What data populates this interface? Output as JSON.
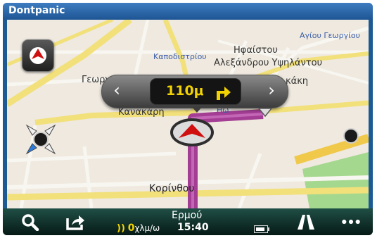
{
  "window": {
    "title": "Dontpanic"
  },
  "map": {
    "streets": {
      "agiou_georgiou": "Αγίου Γεωργίου",
      "kapodistriou": "Καποδιστρίου",
      "ifaistou": "Ηφαίστου",
      "alexandrou_ypsilantou": "Αλεξάνδρου Υψηλάντου",
      "georg_partial": "Γεωργ",
      "akaki_partial": "κάκη",
      "io_partial": "Ηω",
      "kanakari": "Κανακάρη",
      "korinthou": "Κορίνθου"
    }
  },
  "controls": {
    "compass_icon": "north-up-arrow-icon",
    "pan_icon": "pan-arrows-icon",
    "zoom_icon": "zoom-dot-icon"
  },
  "instruction": {
    "distance": "110μ",
    "turn_direction": "right",
    "prev_icon": "‹",
    "next_icon": "›"
  },
  "bottom_bar": {
    "current_street": "Ερμού",
    "speed_value": "0",
    "speed_unit": "χλμ/ω",
    "time": "15:40",
    "icons": [
      "search-icon",
      "share-icon",
      "lanes-icon",
      "more-icon",
      "battery-icon",
      "gps-signal-icon"
    ]
  },
  "colors": {
    "title_bar": "#2a68ad",
    "route": "#a33e94",
    "instruction_text": "#f2d200",
    "bottom_bar": "#0f332c",
    "position_arrow": "#d01010"
  }
}
